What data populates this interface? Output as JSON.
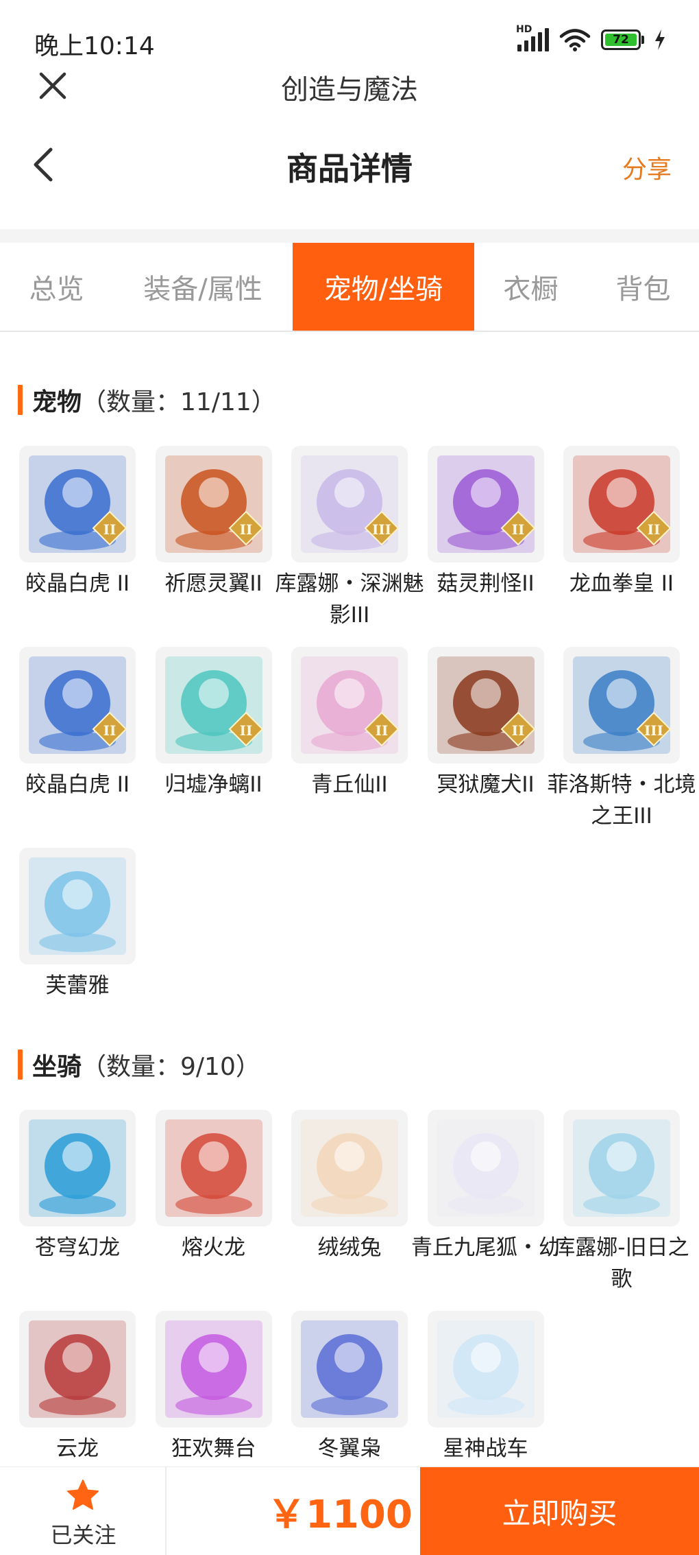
{
  "status": {
    "time": "晚上10:14",
    "hd": "HD",
    "battery": "72"
  },
  "app": {
    "title": "创造与魔法"
  },
  "nav": {
    "title": "商品详情",
    "share": "分享"
  },
  "tabs": [
    {
      "label": "总览",
      "active": false
    },
    {
      "label": "装备/属性",
      "active": false
    },
    {
      "label": "宠物/坐骑",
      "active": true
    },
    {
      "label": "衣橱",
      "active": false
    },
    {
      "label": "背包",
      "active": false
    }
  ],
  "pets": {
    "title": "宠物",
    "count": "（数量：11/11）",
    "items": [
      {
        "name": "皎晶白虎 II",
        "color": "#3a6fd0",
        "tier": "II"
      },
      {
        "name": "祈愿灵翼II",
        "color": "#c9541f",
        "tier": "II"
      },
      {
        "name": "库露娜・深渊魅影III",
        "color": "#c7b8e8",
        "tier": "III"
      },
      {
        "name": "菇灵荆怪II",
        "color": "#9b5ad6",
        "tier": "II"
      },
      {
        "name": "龙血拳皇 II",
        "color": "#c93a2a",
        "tier": "II"
      },
      {
        "name": "皎晶白虎 II",
        "color": "#3a6fd0",
        "tier": "II"
      },
      {
        "name": "归墟净螭II",
        "color": "#4fc6c0",
        "tier": "II"
      },
      {
        "name": "青丘仙II",
        "color": "#e8a8d2",
        "tier": "II"
      },
      {
        "name": "冥狱魔犬II",
        "color": "#8a3a1e",
        "tier": "II"
      },
      {
        "name": "菲洛斯特・北境之王III",
        "color": "#3b7fc7",
        "tier": "III"
      },
      {
        "name": "芙蕾雅",
        "color": "#7ec3ea",
        "tier": ""
      }
    ]
  },
  "mounts": {
    "title": "坐骑",
    "count": "（数量：9/10）",
    "items": [
      {
        "name": "苍穹幻龙",
        "color": "#2a9dd8"
      },
      {
        "name": "熔火龙",
        "color": "#d64a3a"
      },
      {
        "name": "绒绒兔",
        "color": "#f2d6b8"
      },
      {
        "name": "青丘九尾狐・幼",
        "color": "#e9e6f3"
      },
      {
        "name": "库露娜-旧日之歌",
        "color": "#9fd4ea"
      },
      {
        "name": "云龙",
        "color": "#b83a3a"
      },
      {
        "name": "狂欢舞台",
        "color": "#c45ae0"
      },
      {
        "name": "冬翼枭",
        "color": "#5a6fd6"
      },
      {
        "name": "星神战车",
        "color": "#cfe6f6"
      }
    ]
  },
  "bottom": {
    "follow_label": "已关注",
    "price": "￥1100",
    "buy_label": "立即购买"
  }
}
